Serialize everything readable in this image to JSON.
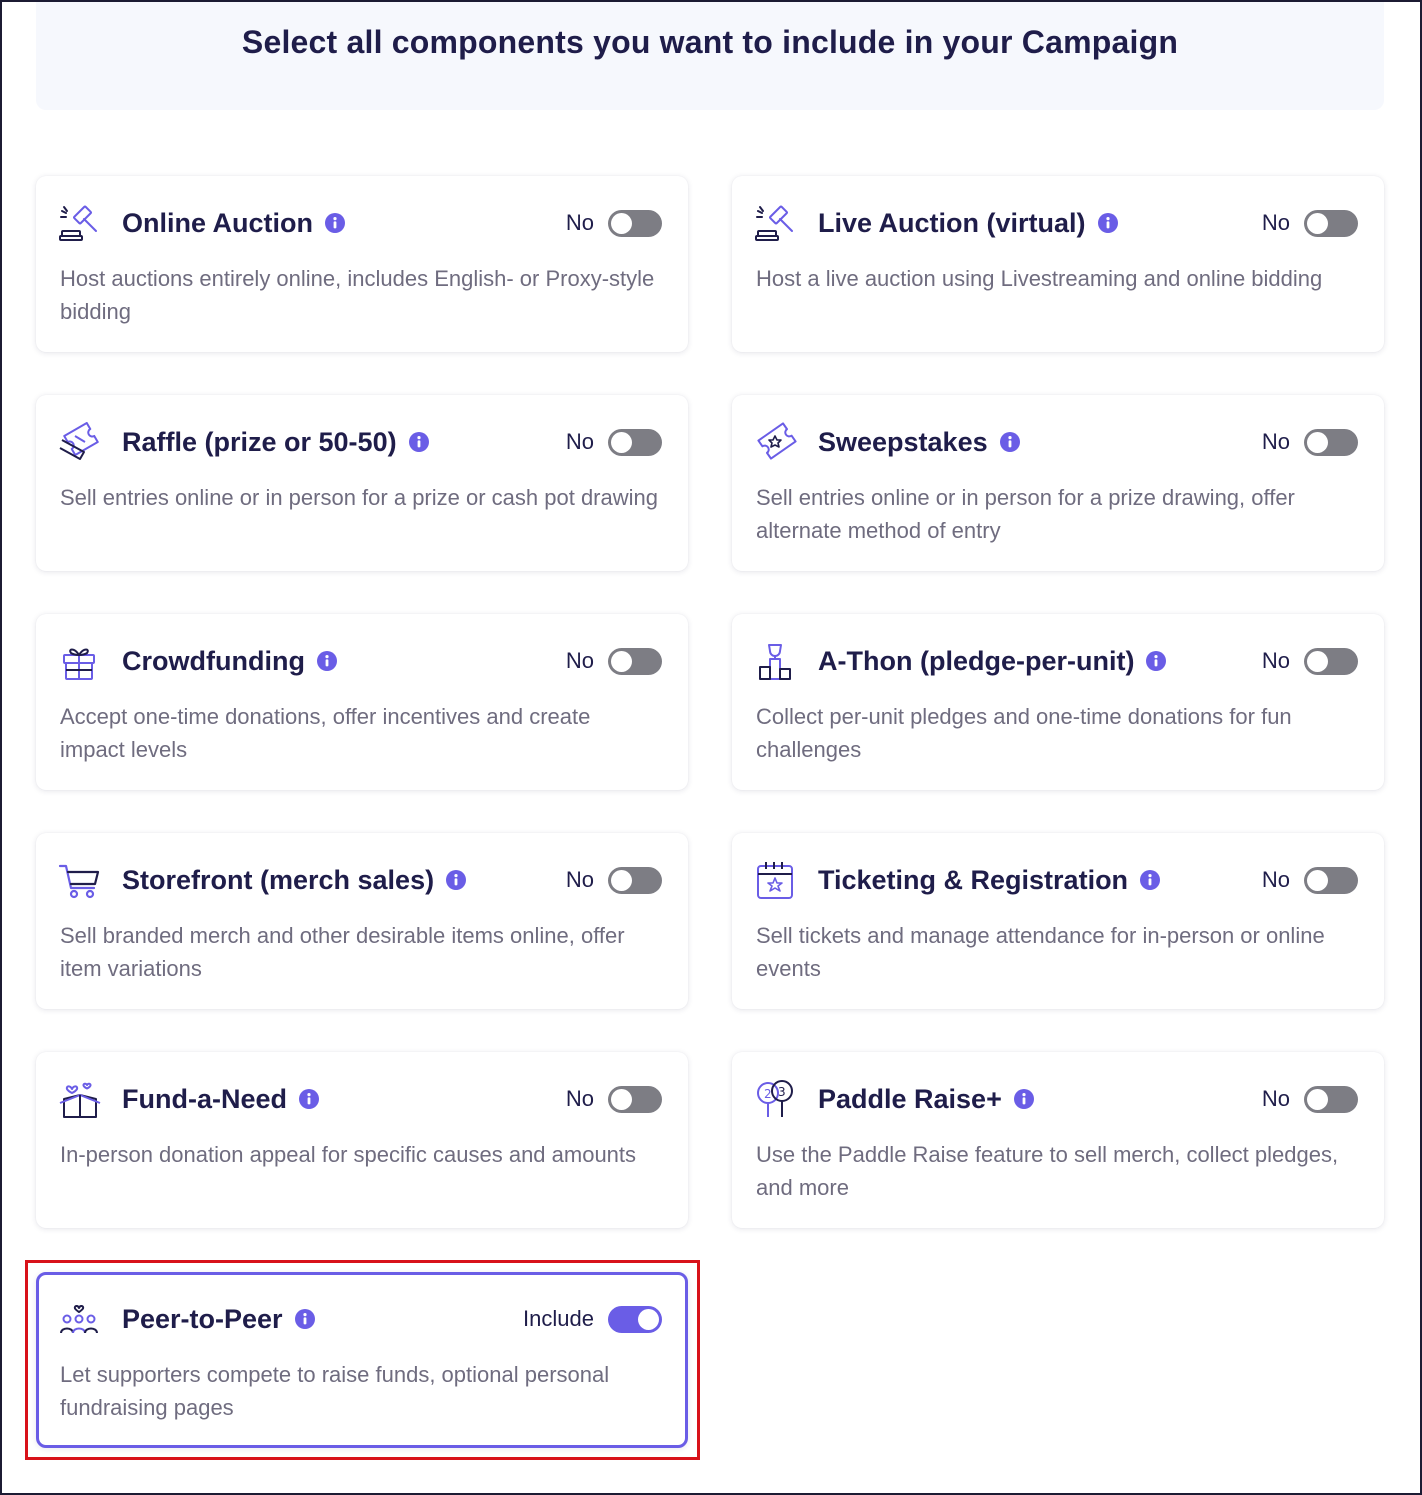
{
  "header": {
    "title": "Select all components you want to include in your Campaign"
  },
  "colors": {
    "accent": "#6a5de6",
    "toggle_off": "#7d7d84",
    "highlight": "#d8121a",
    "text": "#1f1d4a",
    "muted": "#6f6c7f"
  },
  "components": [
    {
      "title": "Online Auction",
      "icon": "gavel-icon",
      "status": "No",
      "on": false,
      "description": "Host auctions entirely online, includes English- or Proxy-style bidding"
    },
    {
      "title": "Live Auction (virtual)",
      "icon": "gavel-icon",
      "status": "No",
      "on": false,
      "description": "Host a live auction using Livestreaming and online bidding"
    },
    {
      "title": "Raffle (prize or 50-50)",
      "icon": "raffle-ticket-icon",
      "status": "No",
      "on": false,
      "description": "Sell entries online or in person for a prize or cash pot drawing"
    },
    {
      "title": "Sweepstakes",
      "icon": "sweepstakes-ticket-icon",
      "status": "No",
      "on": false,
      "description": "Sell entries online or in person for a prize drawing, offer alternate method of entry"
    },
    {
      "title": "Crowdfunding",
      "icon": "gift-box-icon",
      "status": "No",
      "on": false,
      "description": "Accept one-time donations, offer incentives and create impact levels"
    },
    {
      "title": "A-Thon (pledge-per-unit)",
      "icon": "podium-trophy-icon",
      "status": "No",
      "on": false,
      "description": "Collect per-unit pledges and one-time donations for fun challenges"
    },
    {
      "title": "Storefront (merch sales)",
      "icon": "shopping-cart-icon",
      "status": "No",
      "on": false,
      "description": "Sell branded merch and other desirable items online, offer item variations"
    },
    {
      "title": "Ticketing & Registration",
      "icon": "calendar-star-icon",
      "status": "No",
      "on": false,
      "description": "Sell tickets and manage attendance for in-person or online events"
    },
    {
      "title": "Fund-a-Need",
      "icon": "open-box-hearts-icon",
      "status": "No",
      "on": false,
      "description": "In-person donation appeal for specific causes and amounts"
    },
    {
      "title": "Paddle Raise+",
      "icon": "bid-paddles-icon",
      "status": "No",
      "on": false,
      "description": "Use the Paddle Raise feature to sell merch, collect pledges, and more"
    },
    {
      "title": "Peer-to-Peer",
      "icon": "people-group-icon",
      "status": "Include",
      "on": true,
      "description": "Let supporters compete to raise funds, optional personal fundraising pages"
    }
  ]
}
